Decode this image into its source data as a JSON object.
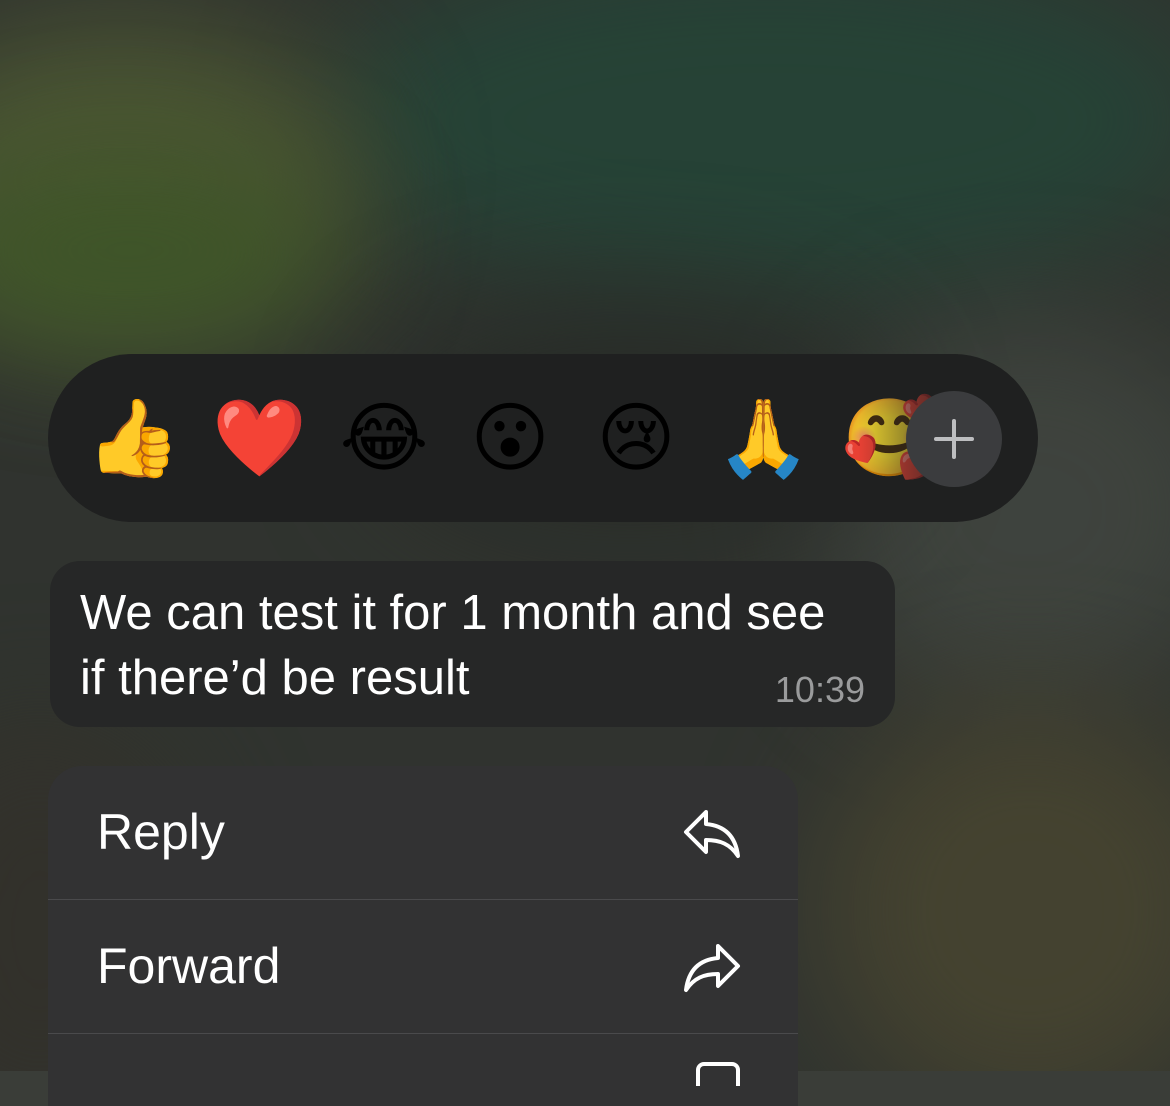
{
  "reactions": {
    "emojis": [
      "👍",
      "❤️",
      "😂",
      "😮",
      "😢",
      "🙏",
      "🥰"
    ],
    "more_icon": "plus-icon"
  },
  "message": {
    "text": "We can test it for 1 month and see\nif there’d be result",
    "time": "10:39"
  },
  "menu": {
    "items": [
      {
        "label": "Reply",
        "icon": "reply-icon"
      },
      {
        "label": "Forward",
        "icon": "forward-icon"
      }
    ]
  },
  "colors": {
    "bar_bg": "#1f2020",
    "bubble_bg": "#262727",
    "menu_bg": "#323233",
    "timestamp": "#9a9b9c"
  }
}
